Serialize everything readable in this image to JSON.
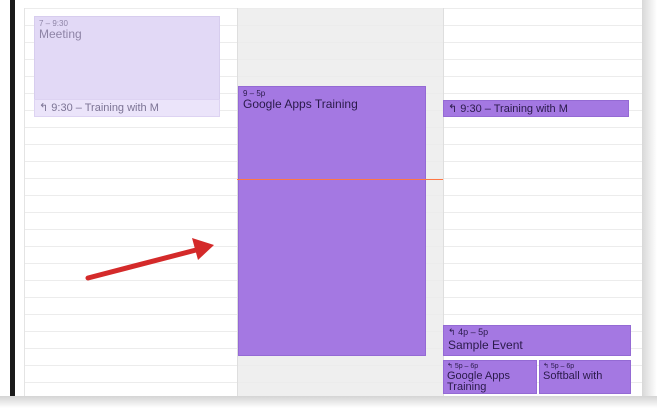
{
  "events": {
    "meeting": {
      "time": "7 – 9:30",
      "title": "Meeting"
    },
    "left_training": {
      "icon": "reply-arrow-icon",
      "label": "9:30 – Training with M"
    },
    "google_apps": {
      "time": "9 – 5p",
      "title": "Google Apps Training"
    },
    "right_training": {
      "icon": "reply-arrow-icon",
      "label": "9:30 – Training with M"
    },
    "sample_event": {
      "icon": "reply-arrow-icon",
      "time": "4p – 5p",
      "title": "Sample Event"
    },
    "google_apps_small": {
      "icon": "reply-arrow-icon",
      "time": "5p – 6p",
      "title": "Google Apps Training"
    },
    "softball": {
      "icon": "reply-arrow-icon",
      "time": "5p – 6p",
      "title": "Softball with"
    }
  },
  "colors": {
    "event_primary": "#a478e2",
    "event_light": "#e2d9f6",
    "now_line": "#ff7744",
    "annotation_arrow": "#d42a2a"
  },
  "annotation": {
    "icon": "red-arrow-icon"
  }
}
